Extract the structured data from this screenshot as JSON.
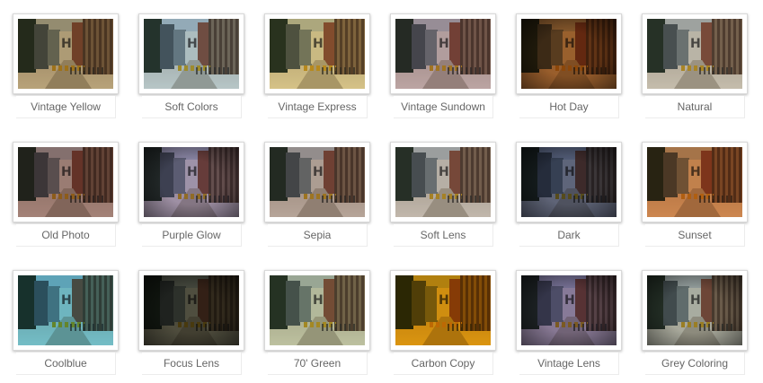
{
  "filters": [
    {
      "label": "Vintage Yellow",
      "icon": "filter-preview-thumbnail",
      "tint": "#c9b48a",
      "vignette": false
    },
    {
      "label": "Soft Colors",
      "icon": "filter-preview-thumbnail",
      "tint": "#c8dbe2",
      "vignette": false
    },
    {
      "label": "Vintage Express",
      "icon": "filter-preview-thumbnail",
      "tint": "#e9d79a",
      "vignette": false
    },
    {
      "label": "Vintage Sundown",
      "icon": "filter-preview-thumbnail",
      "tint": "#cdb6b9",
      "vignette": false
    },
    {
      "label": "Hot Day",
      "icon": "filter-preview-thumbnail",
      "tint": "#b26f35",
      "vignette": true
    },
    {
      "label": "Natural",
      "icon": "filter-preview-thumbnail",
      "tint": "#d7d1c4",
      "vignette": false
    },
    {
      "label": "Old Photo",
      "icon": "filter-preview-thumbnail",
      "tint": "#b39088",
      "vignette": false
    },
    {
      "label": "Purple Glow",
      "icon": "filter-preview-thumbnail",
      "tint": "#b7a9c7",
      "vignette": true
    },
    {
      "label": "Sepia",
      "icon": "filter-preview-thumbnail",
      "tint": "#c7b6ad",
      "vignette": false
    },
    {
      "label": "Soft Lens",
      "icon": "filter-preview-thumbnail",
      "tint": "#d3cbc3",
      "vignette": false
    },
    {
      "label": "Dark",
      "icon": "filter-preview-thumbnail",
      "tint": "#6d7590",
      "vignette": true
    },
    {
      "label": "Sunset",
      "icon": "filter-preview-thumbnail",
      "tint": "#e0955a",
      "vignette": false
    },
    {
      "label": "Coolblue",
      "icon": "filter-preview-thumbnail",
      "tint": "#7fd2e2",
      "vignette": false
    },
    {
      "label": "Focus Lens",
      "icon": "filter-preview-thumbnail",
      "tint": "#5b5a4a",
      "vignette": true
    },
    {
      "label": "70' Green",
      "icon": "filter-preview-thumbnail",
      "tint": "#cfd6b6",
      "vignette": false
    },
    {
      "label": "Carbon Copy",
      "icon": "filter-preview-thumbnail",
      "tint": "#f0a512",
      "vignette": false
    },
    {
      "label": "Vintage Lens",
      "icon": "filter-preview-thumbnail",
      "tint": "#9c8db3",
      "vignette": true
    },
    {
      "label": "Grey Coloring",
      "icon": "filter-preview-thumbnail",
      "tint": "#c3c7bd",
      "vignette": true
    }
  ]
}
